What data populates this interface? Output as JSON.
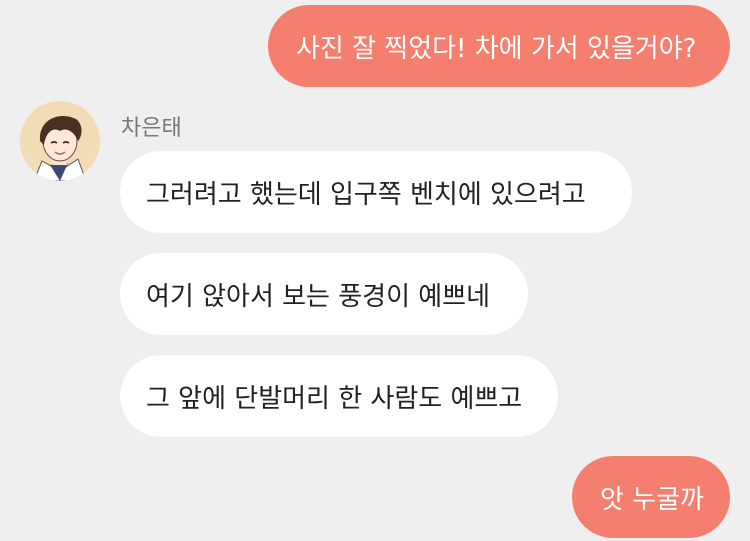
{
  "chat": {
    "contact": {
      "name": "차은태",
      "avatar_icon": "character-portrait"
    },
    "messages": [
      {
        "from": "me",
        "text": "사진 잘 찍었다! 차에 가서 있을거야?"
      },
      {
        "from": "contact",
        "text": "그러려고 했는데 입구쪽 벤치에 있으려고"
      },
      {
        "from": "contact",
        "text": "여기 앉아서 보는 풍경이 예쁘네"
      },
      {
        "from": "contact",
        "text": "그 앞에 단발머리 한 사람도 예쁘고"
      },
      {
        "from": "me",
        "text": "앗 누굴까"
      }
    ]
  },
  "colors": {
    "background": "#efefef",
    "outgoing_bubble": "#f47f6f",
    "incoming_bubble": "#ffffff",
    "sender_name": "#777777"
  }
}
